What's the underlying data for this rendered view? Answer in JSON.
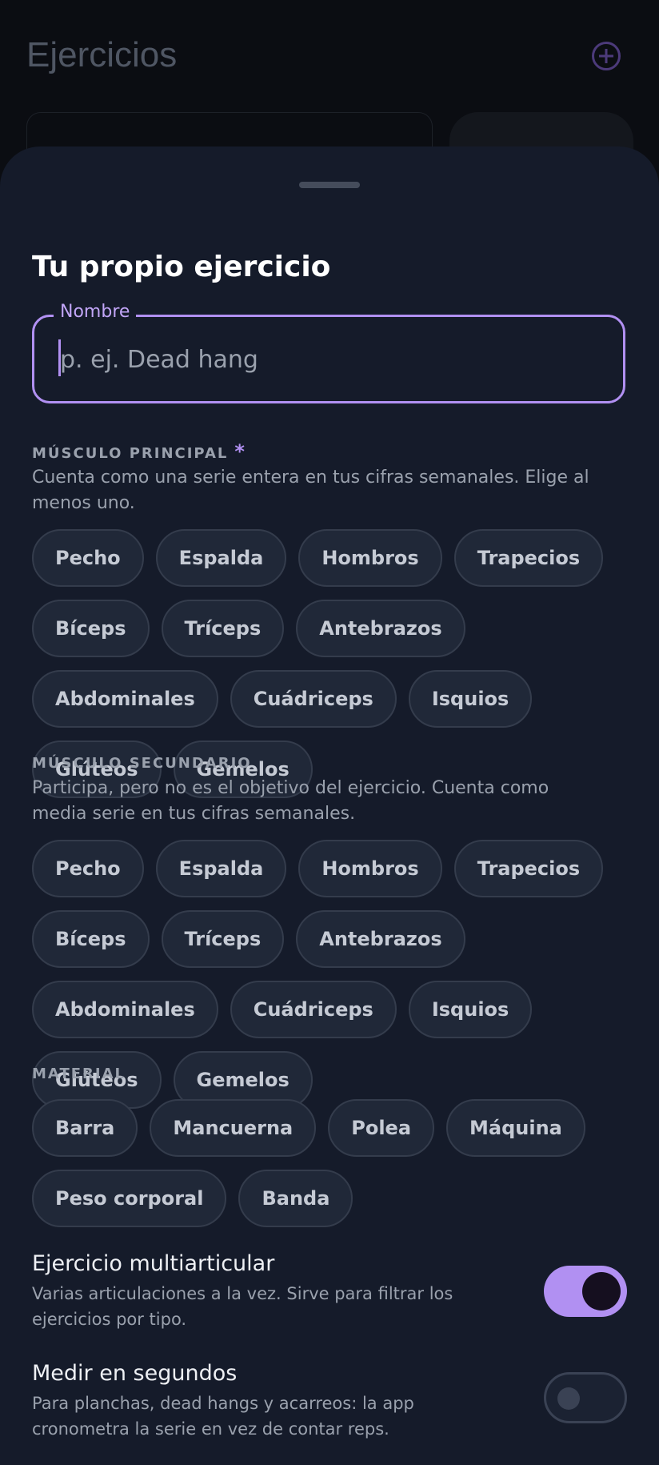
{
  "background": {
    "title": "Ejercicios",
    "add_icon": "plus-circle-icon",
    "search_placeholder": "",
    "filter_label": ""
  },
  "sheet": {
    "title": "Tu propio ejercicio",
    "name_field": {
      "label": "Nombre",
      "placeholder": "p. ej. Dead hang",
      "value": ""
    },
    "primary": {
      "title": "MÚSCULO PRINCIPAL",
      "required_mark": "*",
      "help": "Cuenta como una serie entera en tus cifras semanales. Elige al menos uno.",
      "chips": [
        "Pecho",
        "Espalda",
        "Hombros",
        "Trapecios",
        "Bíceps",
        "Tríceps",
        "Antebrazos",
        "Abdominales",
        "Cuádriceps",
        "Isquios",
        "Glúteos",
        "Gemelos"
      ]
    },
    "secondary": {
      "title": "MÚSCULO SECUNDARIO",
      "help": "Participa, pero no es el objetivo del ejercicio. Cuenta como media serie en tus cifras semanales.",
      "chips": [
        "Pecho",
        "Espalda",
        "Hombros",
        "Trapecios",
        "Bíceps",
        "Tríceps",
        "Antebrazos",
        "Abdominales",
        "Cuádriceps",
        "Isquios",
        "Glúteos",
        "Gemelos"
      ]
    },
    "material": {
      "title": "MATERIAL",
      "chips": [
        "Barra",
        "Mancuerna",
        "Polea",
        "Máquina",
        "Peso corporal",
        "Banda"
      ]
    },
    "multiarticular": {
      "title": "Ejercicio multiarticular",
      "desc": "Varias articulaciones a la vez. Sirve para filtrar los ejercicios por tipo.",
      "enabled": true
    },
    "seconds": {
      "title": "Medir en segundos",
      "desc": "Para planchas, dead hangs y acarreos: la app cronometra la serie en vez de contar reps.",
      "enabled": false
    }
  },
  "colors": {
    "accent": "#b190f2",
    "sheet_bg": "#151b2a",
    "chip_bg": "#202838"
  }
}
